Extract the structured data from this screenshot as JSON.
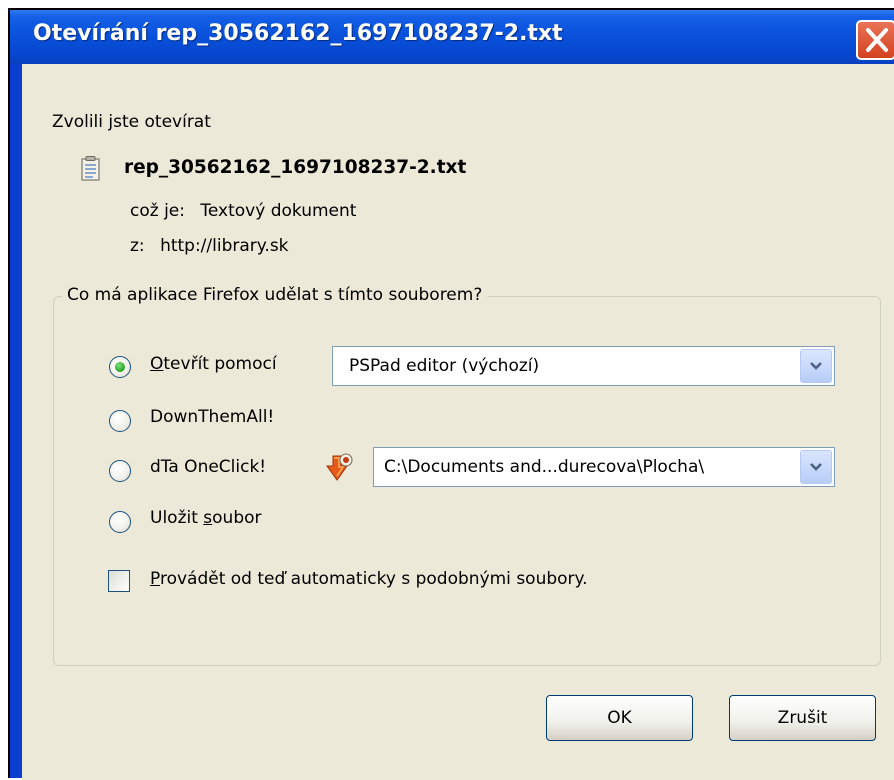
{
  "window": {
    "title": "Otevírání rep_30562162_1697108237-2.txt"
  },
  "intro": {
    "chosen_label": "Zvolili jste otevírat"
  },
  "file": {
    "name": "rep_30562162_1697108237-2.txt",
    "type_label": "což je:",
    "type_value": "Textový dokument",
    "from_label": "z:",
    "from_value": "http://library.sk"
  },
  "group": {
    "legend": "Co má aplikace Firefox udělat s tímto souborem?",
    "options": [
      {
        "label_accel": "O",
        "label_rest": "tevřít pomocí",
        "selected": true
      },
      {
        "label": "DownThemAll!",
        "selected": false
      },
      {
        "label": "dTa OneClick!",
        "selected": false
      },
      {
        "label_pre": "Uložit ",
        "label_accel": "s",
        "label_rest": "oubor",
        "selected": false
      }
    ],
    "open_with_app": "PSPad editor (výchozí)",
    "oneclick_path": "C:\\Documents and...durecova\\Plocha\\",
    "remember": {
      "label_accel": "P",
      "label_rest": "rovádět od teď automaticky s podobnými soubory.",
      "checked": false
    }
  },
  "buttons": {
    "ok": "OK",
    "cancel": "Zrušit"
  },
  "colors": {
    "titlebar": "#0a52dc",
    "dialog_bg": "#ece9d8",
    "radio_selected": "#21a121",
    "close_button": "#d3421f"
  },
  "icons": [
    "close-icon",
    "text-file-icon",
    "dta-oneclick-icon",
    "chevron-down-icon"
  ]
}
